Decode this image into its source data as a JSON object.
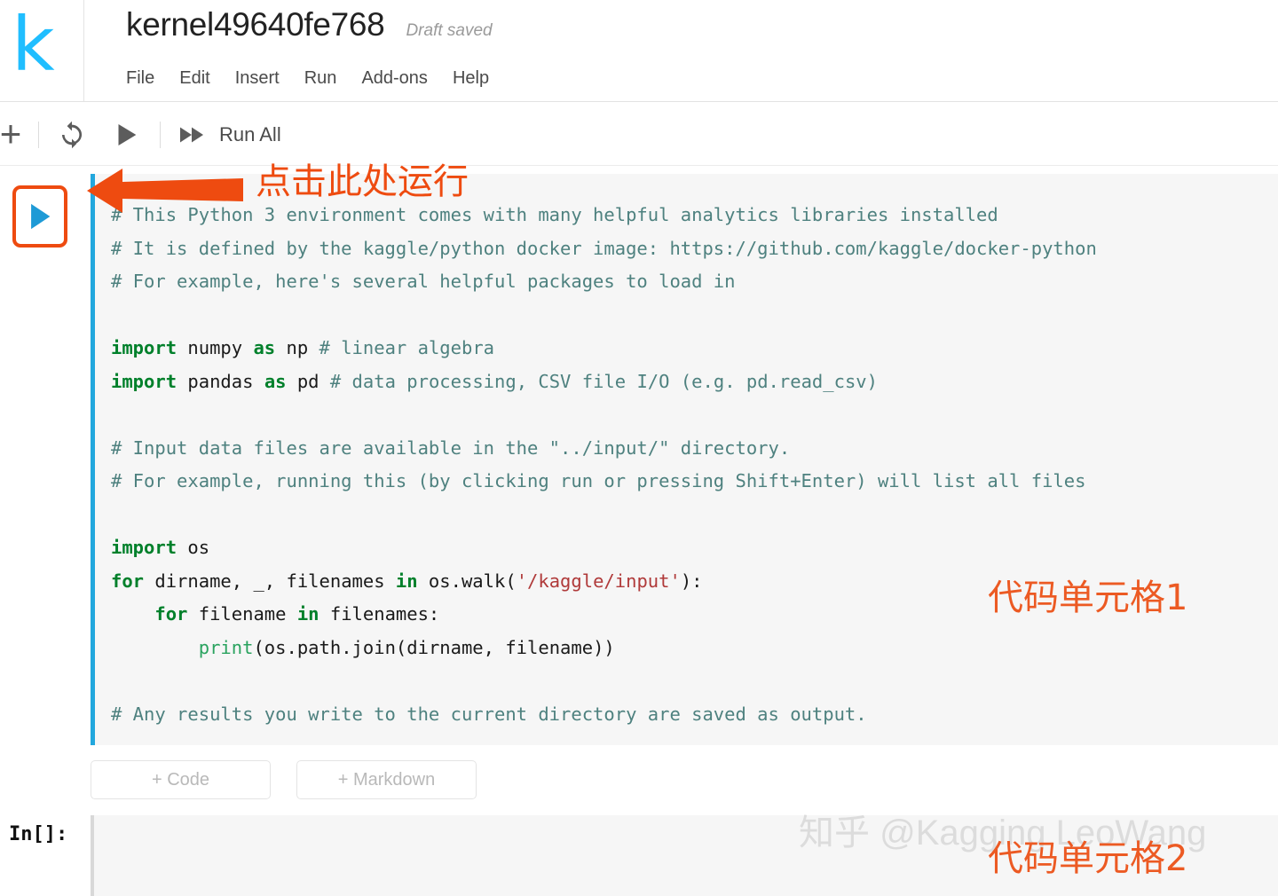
{
  "header": {
    "logo_glyph": "k",
    "logo_name": "kaggle-logo",
    "title": "kernel49640fe768",
    "status": "Draft saved",
    "menu": [
      {
        "label": "File"
      },
      {
        "label": "Edit"
      },
      {
        "label": "Insert"
      },
      {
        "label": "Run"
      },
      {
        "label": "Add-ons"
      },
      {
        "label": "Help"
      }
    ]
  },
  "toolbar": {
    "add_glyph": "+",
    "run_all_label": "Run All"
  },
  "cell1": {
    "code_lines": [
      [
        {
          "t": "# This Python 3 environment comes with many helpful analytics libraries installed",
          "c": "c-comment"
        }
      ],
      [
        {
          "t": "# It is defined by the kaggle/python docker image: https://github.com/kaggle/docker-python",
          "c": "c-comment"
        }
      ],
      [
        {
          "t": "# For example, here's several helpful packages to load in",
          "c": "c-comment"
        }
      ],
      [
        {
          "t": "",
          "c": "c-plain"
        }
      ],
      [
        {
          "t": "import",
          "c": "c-keyword"
        },
        {
          "t": " numpy ",
          "c": "c-plain"
        },
        {
          "t": "as",
          "c": "c-keyword"
        },
        {
          "t": " np ",
          "c": "c-plain"
        },
        {
          "t": "# linear algebra",
          "c": "c-comment"
        }
      ],
      [
        {
          "t": "import",
          "c": "c-keyword"
        },
        {
          "t": " pandas ",
          "c": "c-plain"
        },
        {
          "t": "as",
          "c": "c-keyword"
        },
        {
          "t": " pd ",
          "c": "c-plain"
        },
        {
          "t": "# data processing, CSV file I/O (e.g. pd.read_csv)",
          "c": "c-comment"
        }
      ],
      [
        {
          "t": "",
          "c": "c-plain"
        }
      ],
      [
        {
          "t": "# Input data files are available in the \"../input/\" directory.",
          "c": "c-comment"
        }
      ],
      [
        {
          "t": "# For example, running this (by clicking run or pressing Shift+Enter) will list all files",
          "c": "c-comment"
        }
      ],
      [
        {
          "t": "",
          "c": "c-plain"
        }
      ],
      [
        {
          "t": "import",
          "c": "c-keyword"
        },
        {
          "t": " os",
          "c": "c-plain"
        }
      ],
      [
        {
          "t": "for",
          "c": "c-keyword"
        },
        {
          "t": " dirname, _, filenames ",
          "c": "c-plain"
        },
        {
          "t": "in",
          "c": "c-keyword"
        },
        {
          "t": " os.walk(",
          "c": "c-plain"
        },
        {
          "t": "'/kaggle/input'",
          "c": "c-string"
        },
        {
          "t": "):",
          "c": "c-plain"
        }
      ],
      [
        {
          "t": "    ",
          "c": "c-plain"
        },
        {
          "t": "for",
          "c": "c-keyword"
        },
        {
          "t": " filename ",
          "c": "c-plain"
        },
        {
          "t": "in",
          "c": "c-keyword"
        },
        {
          "t": " filenames:",
          "c": "c-plain"
        }
      ],
      [
        {
          "t": "        ",
          "c": "c-plain"
        },
        {
          "t": "print",
          "c": "c-builtin"
        },
        {
          "t": "(os.path.join(dirname, filename))",
          "c": "c-plain"
        }
      ],
      [
        {
          "t": "",
          "c": "c-plain"
        }
      ],
      [
        {
          "t": "# Any results you write to the current directory are saved as output.",
          "c": "c-comment"
        }
      ]
    ]
  },
  "add_buttons": {
    "code_label": "+ Code",
    "markdown_label": "+ Markdown"
  },
  "cell2": {
    "prompt_label": "In[]:"
  },
  "annotations": {
    "click_to_run": "点击此处运行",
    "cell1_label": "代码单元格1",
    "cell2_label": "代码单元格2",
    "watermark": "知乎 @Kagging LeoWang"
  },
  "colors": {
    "kaggle_cyan": "#20beff",
    "cell_border_blue": "#22a7dd",
    "annotation_orange": "#ee4b10",
    "annotation_orange2": "#ec5a23",
    "code_bg": "#f6f6f6",
    "comment_teal": "#4e817f",
    "keyword_green": "#00802b",
    "string_red": "#b03a3a"
  }
}
